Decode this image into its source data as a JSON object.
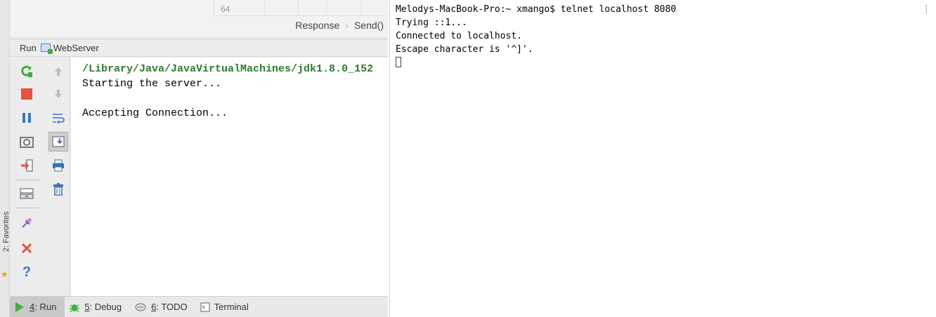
{
  "ide": {
    "favorites_label": "2: Favorites",
    "editor": {
      "line_number": "64",
      "breadcrumbs": [
        "Response",
        "Send()"
      ],
      "breadcrumb_sep": "›"
    },
    "run_panel": {
      "title": "Run",
      "config_name": "WebServer"
    },
    "console": {
      "path_line": "/Library/Java/JavaVirtualMachines/jdk1.8.0_152",
      "lines": [
        "Starting the server...",
        "",
        "Accepting Connection..."
      ]
    },
    "toolbar_left": [
      "rerun-icon",
      "stop-icon",
      "pause-icon",
      "camera-icon",
      "exit-icon",
      "layout-icon",
      "pin-icon",
      "close-icon",
      "help-icon"
    ],
    "toolbar_right": [
      "up-arrow-icon",
      "down-arrow-icon",
      "soft-wrap-icon",
      "scroll-to-end-icon",
      "print-icon",
      "trash-icon"
    ],
    "bottom_tabs": [
      {
        "key": "4",
        "label": ": Run"
      },
      {
        "key": "5",
        "label": ": Debug"
      },
      {
        "key": "6",
        "label": ": TODO"
      },
      {
        "key": "",
        "label": "Terminal"
      }
    ],
    "colors": {
      "run_green": "#3fae3f",
      "stop_red": "#e5533f",
      "pause_blue": "#3a78c4",
      "path_green": "#2f7a2f"
    }
  },
  "terminal": {
    "lines": [
      "Melodys-MacBook-Pro:~ xmango$ telnet localhost 8080",
      "Trying ::1...",
      "Connected to localhost.",
      "Escape character is '^]'."
    ],
    "edge_mark": "]"
  }
}
